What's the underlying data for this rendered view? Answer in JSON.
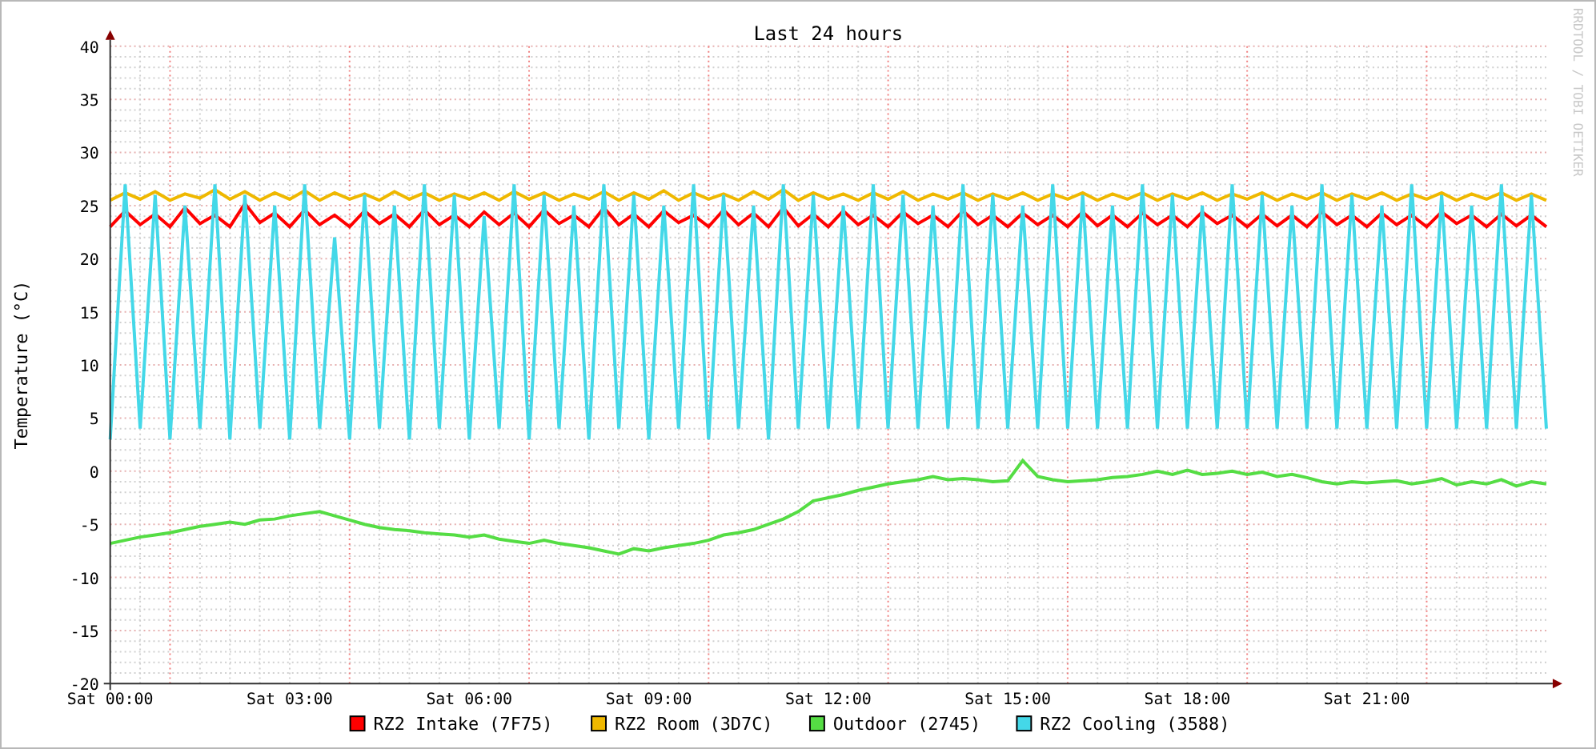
{
  "chart": {
    "credit": "RRDTOOL / TOBI OETIKER",
    "chart_data": {
      "type": "line",
      "title": "Last 24 hours",
      "ylabel": "Temperature (°C)",
      "ylim": [
        -20,
        40
      ],
      "grid": true,
      "legend": "bottom",
      "yticks": [
        -20,
        -15,
        -10,
        -5,
        0,
        5,
        10,
        15,
        20,
        25,
        30,
        35,
        40
      ],
      "categories": [
        "Sat 00:00",
        null,
        null,
        null,
        null,
        null,
        null,
        null,
        null,
        null,
        null,
        null,
        "Sat 03:00",
        null,
        null,
        null,
        null,
        null,
        null,
        null,
        null,
        null,
        null,
        null,
        "Sat 06:00",
        null,
        null,
        null,
        null,
        null,
        null,
        null,
        null,
        null,
        null,
        null,
        "Sat 09:00",
        null,
        null,
        null,
        null,
        null,
        null,
        null,
        null,
        null,
        null,
        null,
        "Sat 12:00",
        null,
        null,
        null,
        null,
        null,
        null,
        null,
        null,
        null,
        null,
        null,
        "Sat 15:00",
        null,
        null,
        null,
        null,
        null,
        null,
        null,
        null,
        null,
        null,
        null,
        "Sat 18:00",
        null,
        null,
        null,
        null,
        null,
        null,
        null,
        null,
        null,
        null,
        null,
        "Sat 21:00",
        null,
        null,
        null,
        null,
        null,
        null,
        null,
        null,
        null,
        null,
        null,
        null
      ],
      "series": [
        {
          "name": "RZ2 Intake (7F75)",
          "color": "#ff0000",
          "values": [
            23,
            24.5,
            23.2,
            24.2,
            23,
            24.8,
            23.3,
            24.1,
            23,
            25.2,
            23.4,
            24.3,
            23,
            24.6,
            23.2,
            24.1,
            23,
            24.5,
            23.3,
            24.2,
            23,
            24.6,
            23.2,
            24.1,
            23,
            24.4,
            23.2,
            24.3,
            23,
            24.6,
            23.3,
            24.1,
            23,
            24.8,
            23.2,
            24.2,
            23,
            24.5,
            23.4,
            24.1,
            23,
            24.6,
            23.2,
            24.3,
            23,
            24.8,
            23.1,
            24.2,
            23,
            24.5,
            23.2,
            24.1,
            23,
            24.4,
            23.3,
            24.1,
            23,
            24.5,
            23.2,
            24.1,
            23,
            24.3,
            23.2,
            24.1,
            23,
            24.4,
            23.1,
            24.1,
            23,
            24.3,
            23.2,
            24.1,
            23,
            24.4,
            23.3,
            24.1,
            23,
            24.2,
            23.1,
            24.1,
            23,
            24.4,
            23.2,
            24.1,
            23,
            24.3,
            23.2,
            24.1,
            23,
            24.4,
            23.3,
            24.1,
            23,
            24.2,
            23.1,
            24.1,
            23
          ]
        },
        {
          "name": "RZ2 Room (3D7C)",
          "color": "#efb800",
          "values": [
            25.5,
            26.2,
            25.6,
            26.3,
            25.5,
            26.1,
            25.7,
            26.5,
            25.6,
            26.3,
            25.5,
            26.2,
            25.6,
            26.4,
            25.5,
            26.2,
            25.6,
            26.1,
            25.5,
            26.3,
            25.6,
            26.2,
            25.5,
            26.1,
            25.6,
            26.2,
            25.5,
            26.3,
            25.6,
            26.2,
            25.5,
            26.1,
            25.6,
            26.3,
            25.5,
            26.2,
            25.6,
            26.4,
            25.5,
            26.2,
            25.6,
            26.1,
            25.5,
            26.3,
            25.6,
            26.5,
            25.5,
            26.2,
            25.6,
            26.1,
            25.5,
            26.2,
            25.6,
            26.3,
            25.5,
            26.1,
            25.6,
            26.2,
            25.5,
            26.1,
            25.6,
            26.2,
            25.5,
            26.1,
            25.6,
            26.2,
            25.5,
            26.1,
            25.6,
            26.2,
            25.5,
            26.1,
            25.6,
            26.2,
            25.5,
            26.1,
            25.6,
            26.2,
            25.5,
            26.1,
            25.6,
            26.2,
            25.5,
            26.1,
            25.6,
            26.2,
            25.5,
            26.1,
            25.6,
            26.2,
            25.5,
            26.1,
            25.6,
            26.2,
            25.5,
            26.1,
            25.5
          ]
        },
        {
          "name": "Outdoor (2745)",
          "color": "#55dd44",
          "values": [
            -6.8,
            -6.5,
            -6.2,
            -6,
            -5.8,
            -5.5,
            -5.2,
            -5,
            -4.8,
            -5,
            -4.6,
            -4.5,
            -4.2,
            -4,
            -3.8,
            -4.2,
            -4.6,
            -5,
            -5.3,
            -5.5,
            -5.6,
            -5.8,
            -5.9,
            -6,
            -6.2,
            -6,
            -6.4,
            -6.6,
            -6.8,
            -6.5,
            -6.8,
            -7,
            -7.2,
            -7.5,
            -7.8,
            -7.3,
            -7.5,
            -7.2,
            -7,
            -6.8,
            -6.5,
            -6,
            -5.8,
            -5.5,
            -5,
            -4.5,
            -3.8,
            -2.8,
            -2.5,
            -2.2,
            -1.8,
            -1.5,
            -1.2,
            -1,
            -0.8,
            -0.5,
            -0.8,
            -0.7,
            -0.8,
            -1,
            -0.9,
            1,
            -0.5,
            -0.8,
            -1,
            -0.9,
            -0.8,
            -0.6,
            -0.5,
            -0.3,
            0,
            -0.3,
            0.1,
            -0.3,
            -0.2,
            0,
            -0.3,
            -0.1,
            -0.5,
            -0.3,
            -0.6,
            -1,
            -1.2,
            -1,
            -1.1,
            -1,
            -0.9,
            -1.2,
            -1,
            -0.7,
            -1.3,
            -1,
            -1.2,
            -0.8,
            -1.4,
            -1,
            -1.2
          ]
        },
        {
          "name": "RZ2 Cooling (3588)",
          "color": "#44d8e8",
          "values": [
            3,
            27,
            4,
            26,
            3,
            25,
            4,
            27,
            3,
            26,
            4,
            25,
            3,
            27,
            4,
            22,
            3,
            26,
            4,
            25,
            3,
            27,
            4,
            26,
            3,
            24,
            4,
            27,
            3,
            26,
            4,
            25,
            3,
            27,
            4,
            26,
            3,
            25,
            4,
            27,
            3,
            26,
            4,
            25,
            3,
            27,
            4,
            26,
            4,
            25,
            4,
            27,
            4,
            26,
            4,
            25,
            4,
            27,
            4,
            26,
            4,
            25,
            4,
            27,
            4,
            26,
            4,
            25,
            4,
            27,
            4,
            26,
            4,
            25,
            4,
            27,
            4,
            26,
            4,
            25,
            4,
            27,
            4,
            26,
            4,
            25,
            4,
            27,
            4,
            26,
            4,
            25,
            4,
            27,
            4,
            26,
            4
          ]
        }
      ]
    }
  }
}
